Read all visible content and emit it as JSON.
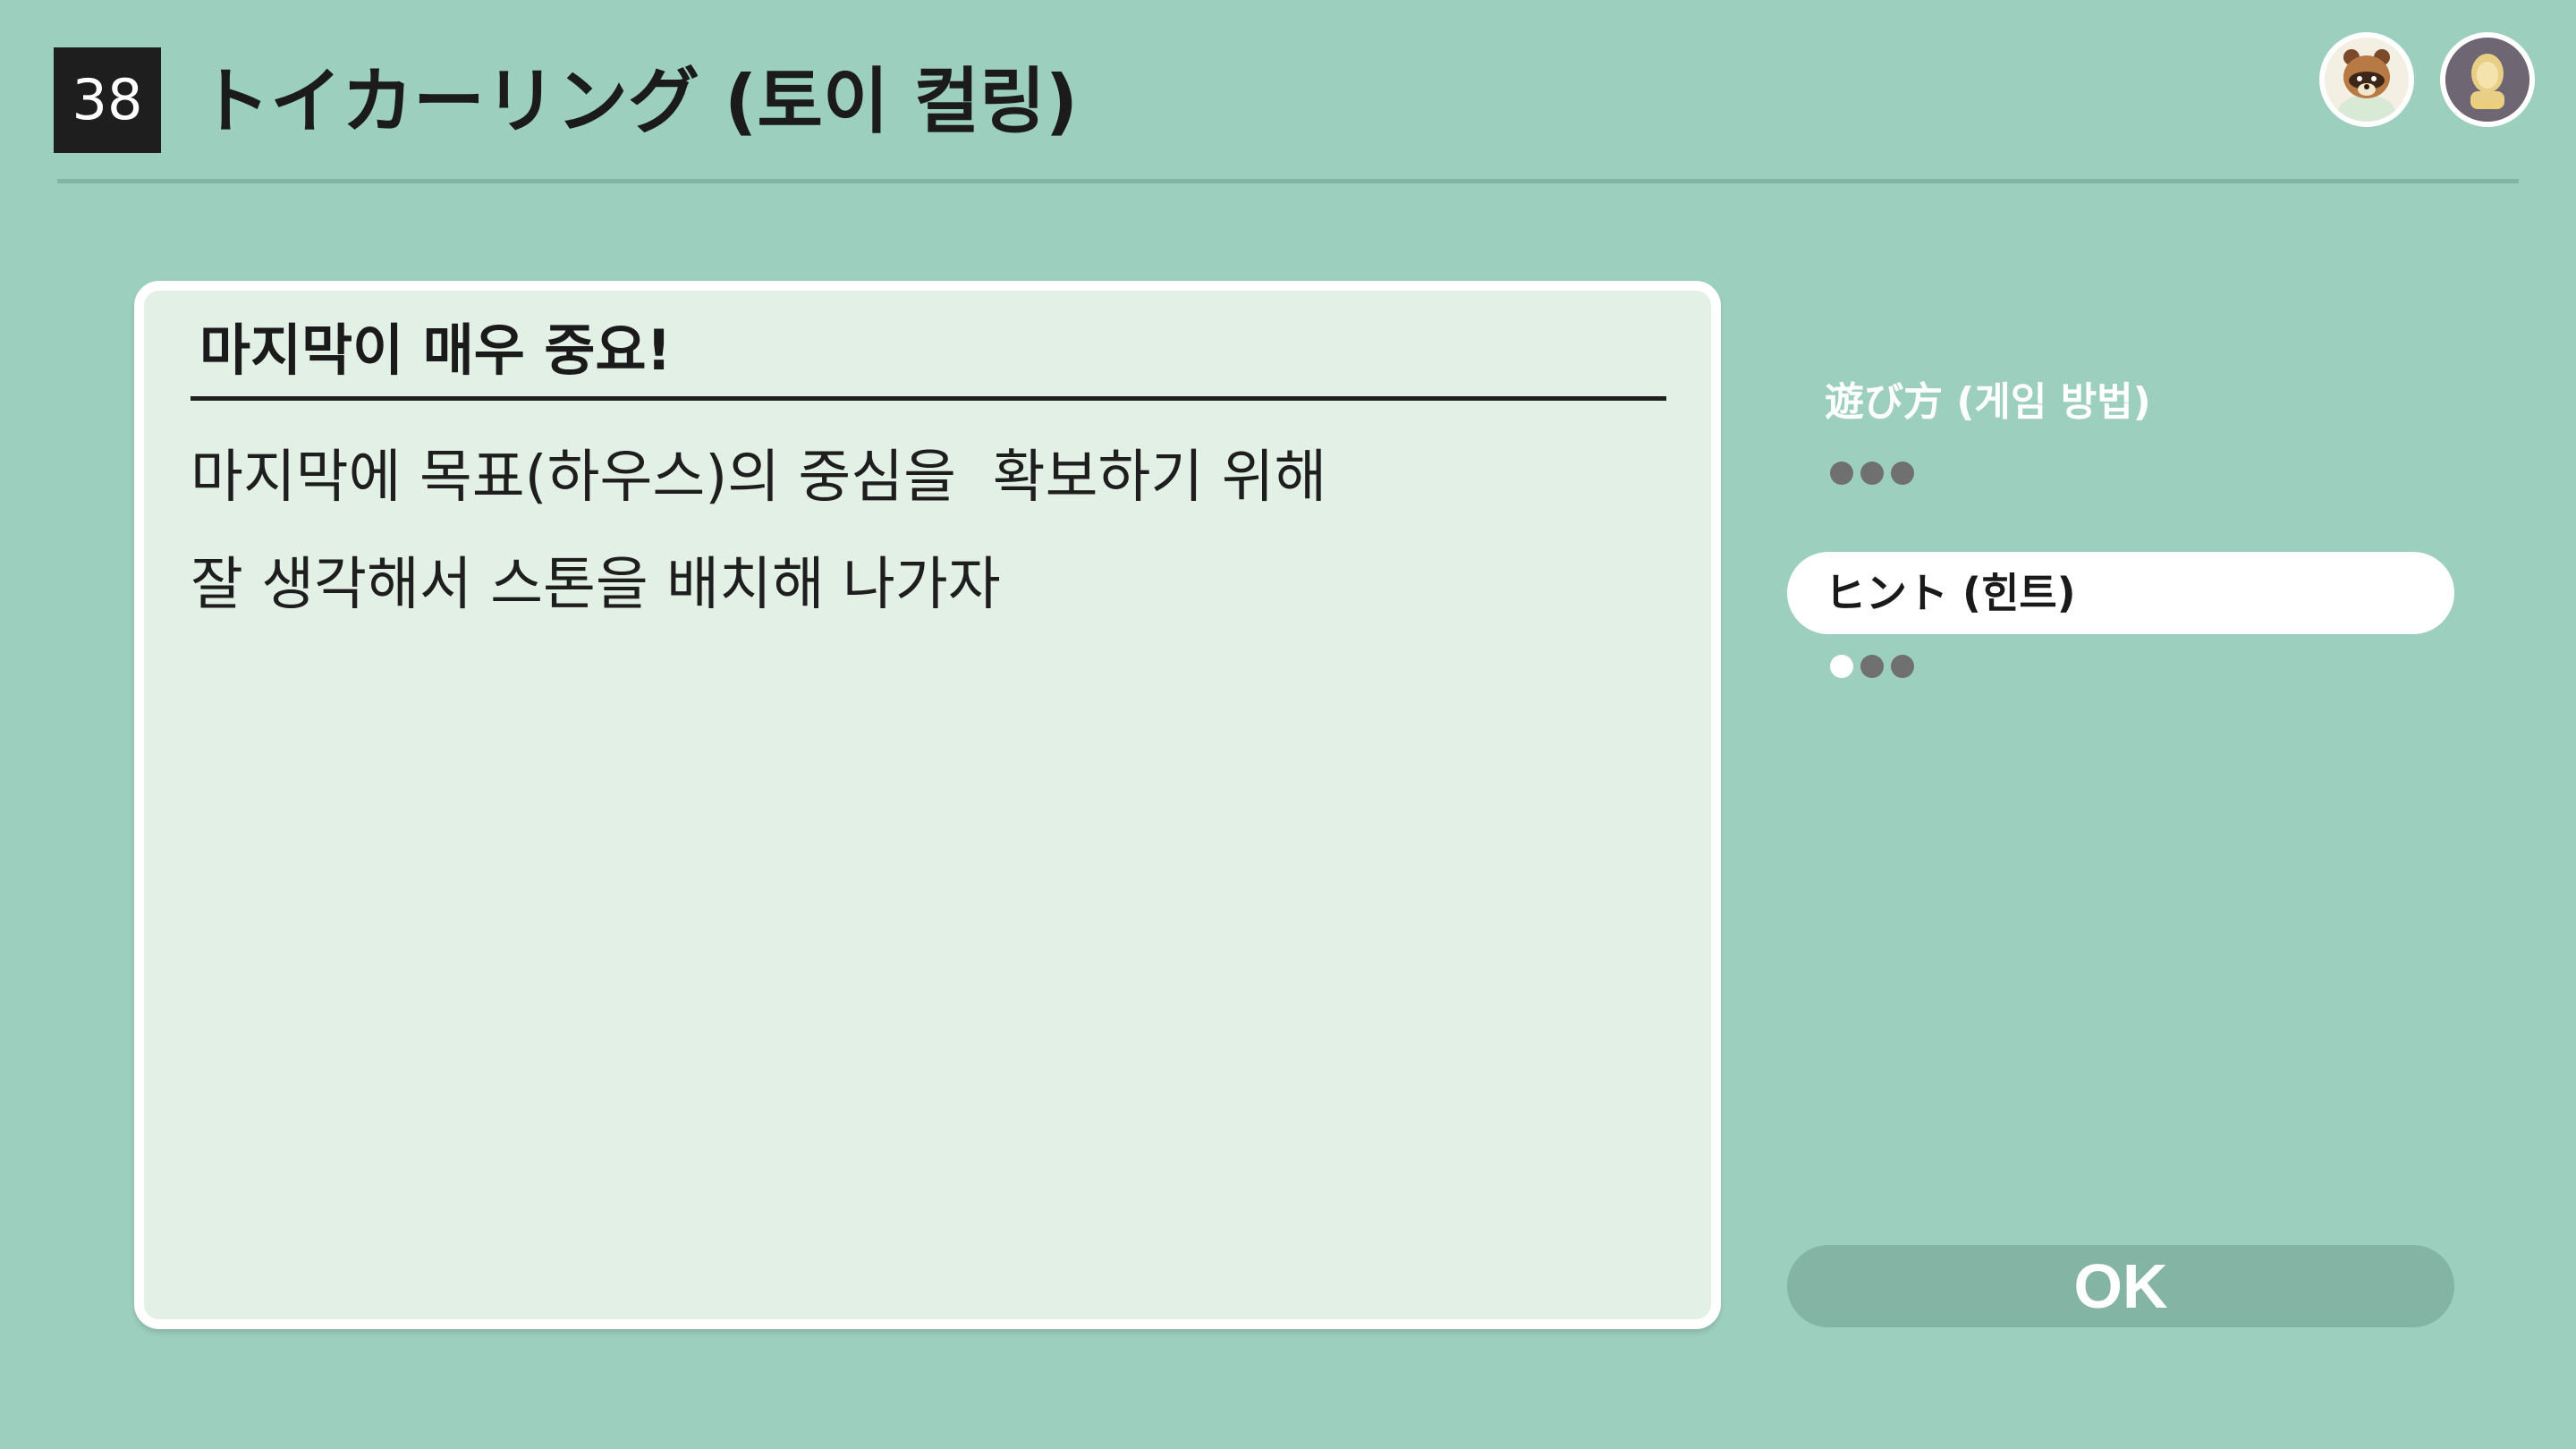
{
  "header": {
    "number": "38",
    "title": "トイカーリング (토이 컬링)"
  },
  "avatars": [
    {
      "name": "tom-nook-avatar"
    },
    {
      "name": "player-avatar"
    }
  ],
  "panel": {
    "heading": "마지막이 매우 중요!",
    "lines": [
      "마지막에 목표(하우스)의 중심을  확보하기 위해",
      "잘 생각해서 스톤을 배치해 나가자"
    ]
  },
  "menu": {
    "items": [
      {
        "label": "遊び方 (게임 방법)",
        "selected": false,
        "dots_active": 0,
        "dots_total": 3
      },
      {
        "label": "ヒント (힌트)",
        "selected": true,
        "dots_active": 1,
        "dots_total": 3
      }
    ]
  },
  "ok_button": {
    "label": "OK"
  },
  "colors": {
    "background": "#9dcfbe",
    "panel": "#e3f0e5",
    "accent_dark": "#84b4a4",
    "number_box": "#1e1e1e"
  }
}
